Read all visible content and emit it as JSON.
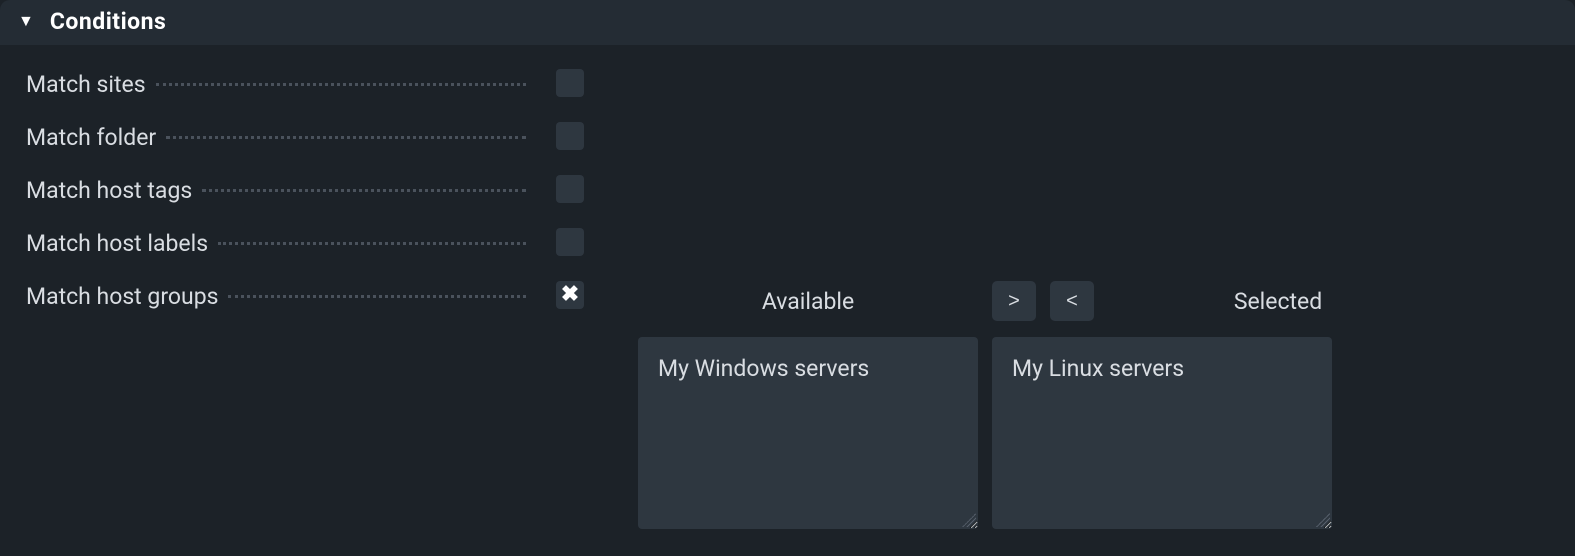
{
  "section": {
    "title": "Conditions"
  },
  "conditions": [
    {
      "label": "Match sites",
      "checked": false
    },
    {
      "label": "Match folder",
      "checked": false
    },
    {
      "label": "Match host tags",
      "checked": false
    },
    {
      "label": "Match host labels",
      "checked": false
    },
    {
      "label": "Match host groups",
      "checked": true
    }
  ],
  "dualList": {
    "availableHeader": "Available",
    "selectedHeader": "Selected",
    "moveRightLabel": ">",
    "moveLeftLabel": "<",
    "available": [
      "My Windows servers"
    ],
    "selected": [
      "My Linux servers"
    ]
  }
}
